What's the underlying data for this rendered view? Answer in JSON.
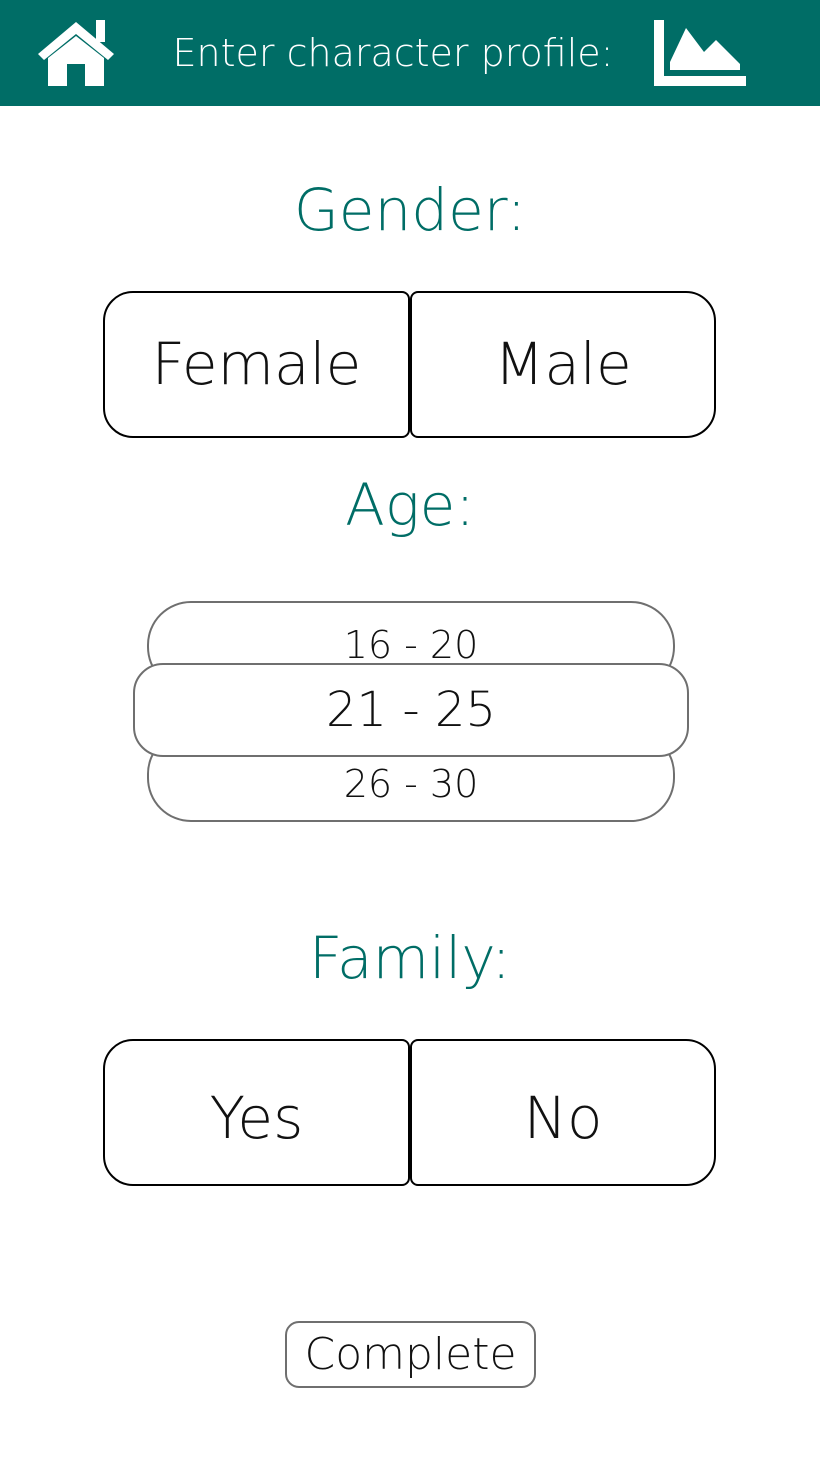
{
  "header": {
    "title": "Enter character profile:",
    "home_icon": "home-icon",
    "chart_icon": "area-chart-icon",
    "background_color": "#006d66"
  },
  "gender": {
    "label": "Gender:",
    "options": [
      "Female",
      "Male"
    ]
  },
  "age": {
    "label": "Age:",
    "options": [
      "16 - 20",
      "21 - 25",
      "26 - 30"
    ],
    "selected": "21 - 25"
  },
  "family": {
    "label": "Family:",
    "options": [
      "Yes",
      "No"
    ]
  },
  "complete_label": "Complete",
  "accent_color": "#006d66"
}
